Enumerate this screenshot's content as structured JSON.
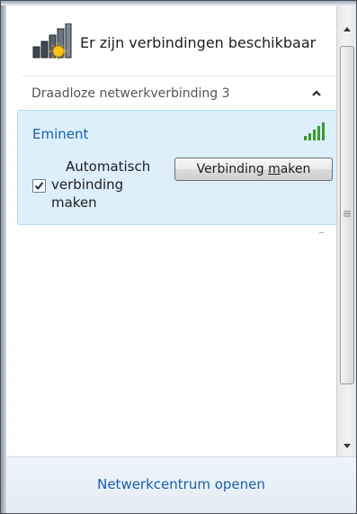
{
  "header": {
    "title": "Er zijn verbindingen beschikbaar",
    "icon": "network-signal-sun-icon"
  },
  "section": {
    "label": "Draadloze netwerkverbinding 3",
    "chevron": "chevron-up-icon"
  },
  "network": {
    "name": "Eminent",
    "signal_icon": "signal-bars-icon",
    "auto_connect_checked": true,
    "auto_connect_line1": "Automatisch",
    "auto_connect_line2": "verbinding",
    "auto_connect_line3": "maken",
    "connect_button_prefix": "Verbinding ",
    "connect_button_mnemonic": "m",
    "connect_button_suffix": "aken"
  },
  "footer": {
    "link": "Netwerkcentrum openen"
  },
  "colors": {
    "link": "#1a5fa8",
    "selected_bg": "#dceffb",
    "signal_green": "#3a9a2a"
  }
}
